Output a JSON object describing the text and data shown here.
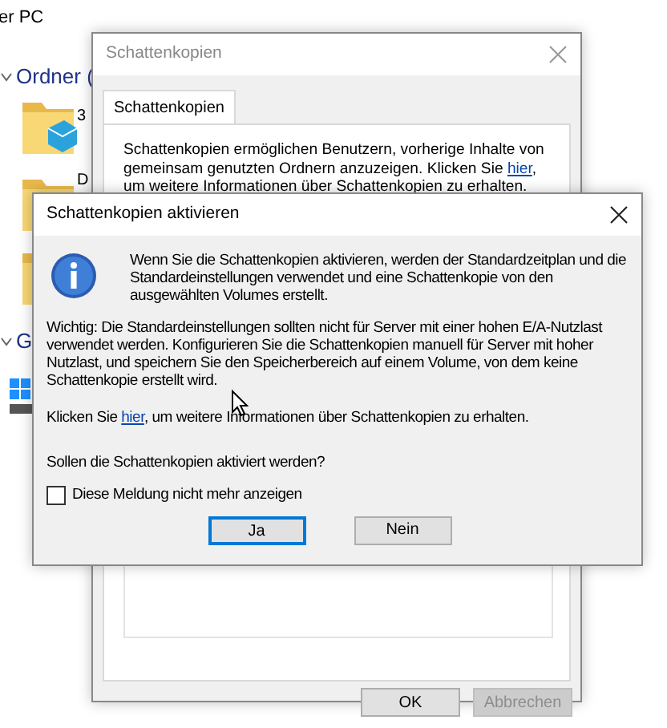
{
  "explorer": {
    "title": "er PC",
    "section_1": "Ordner (",
    "items": [
      {
        "label": "3",
        "kind": "objects"
      },
      {
        "label": "D",
        "kind": "documents"
      },
      {
        "kind": "folder"
      }
    ],
    "section_2": "G"
  },
  "properties_dialog": {
    "title": "Schattenkopien",
    "tabs": [
      {
        "label": "Schattenkopien",
        "selected": true
      }
    ],
    "description": {
      "before": "Schattenkopien ermöglichen Benutzern, vorherige Inhalte von gemeinsam genutzten Ordnern anzuzeigen. Klicken Sie ",
      "link": "hier",
      "after": ", um weitere Informationen über Schattenkopien zu erhalten."
    },
    "buttons": [
      {
        "label": "OK",
        "disabled": false
      },
      {
        "label": "Abbrechen",
        "disabled": true
      }
    ]
  },
  "confirm_dialog": {
    "title": "Schattenkopien aktivieren",
    "message": "Wenn Sie die Schattenkopien aktivieren, werden der Standardzeitplan und die Standardeinstellungen verwendet und eine Schattenkopie von den ausgewählten Volumes erstellt.",
    "warning": "Wichtig: Die Standardeinstellungen sollten nicht für Server mit einer hohen E/A-Nutzlast verwendet werden. Konfigurieren Sie die Schattenkopien manuell für Server mit hoher Nutzlast, und speichern Sie den Speicherbereich auf einem Volume, von dem keine Schattenkopie erstellt wird.",
    "info": {
      "before": "Klicken Sie ",
      "link": "hier",
      "after": ", um weitere Informationen über Schattenkopien zu erhalten."
    },
    "question": "Sollen die Schattenkopien aktiviert werden?",
    "checkbox": {
      "label": "Diese Meldung nicht mehr anzeigen",
      "checked": false
    },
    "buttons": [
      {
        "label": "Ja",
        "default": true
      },
      {
        "label": "Nein",
        "default": false
      }
    ]
  }
}
